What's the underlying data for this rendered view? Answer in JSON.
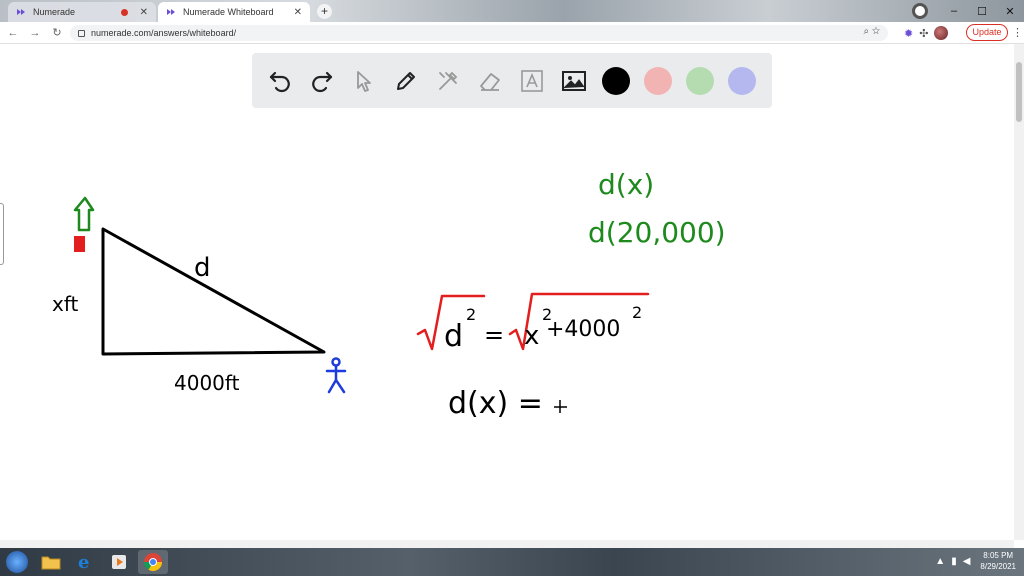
{
  "browser": {
    "tabs": [
      {
        "title": "Numerade",
        "recording": true
      },
      {
        "title": "Numerade Whiteboard",
        "active": true
      }
    ],
    "url": "numerade.com/answers/whiteboard/",
    "update_label": "Update"
  },
  "whiteboard": {
    "tools": [
      "undo-icon",
      "redo-icon",
      "pointer-icon",
      "pen-icon",
      "tools-icon",
      "eraser-icon",
      "text-icon",
      "image-icon"
    ],
    "colors": [
      "#000000",
      "#f2b3b3",
      "#b5dbb0",
      "#b5b8ee"
    ],
    "ink_colors": {
      "black": "#000000",
      "green": "#1e8a1e",
      "red": "#e31e1e",
      "blue": "#1e3cdc"
    },
    "drawing": {
      "label_d": "d",
      "label_x": "xft",
      "label_base": "4000ft",
      "notes": [
        "d(x)",
        "d(20,000)"
      ],
      "equation_lhs": "d",
      "equation_lhs_exp": "2",
      "equation_eq": "=",
      "equation_x": "x",
      "equation_x_exp": "2",
      "equation_plus": "+4000",
      "equation_const_exp": "2",
      "equation2": "d(x) ="
    }
  },
  "taskbar": {
    "time": "8:05 PM",
    "date": "8/29/2021"
  }
}
